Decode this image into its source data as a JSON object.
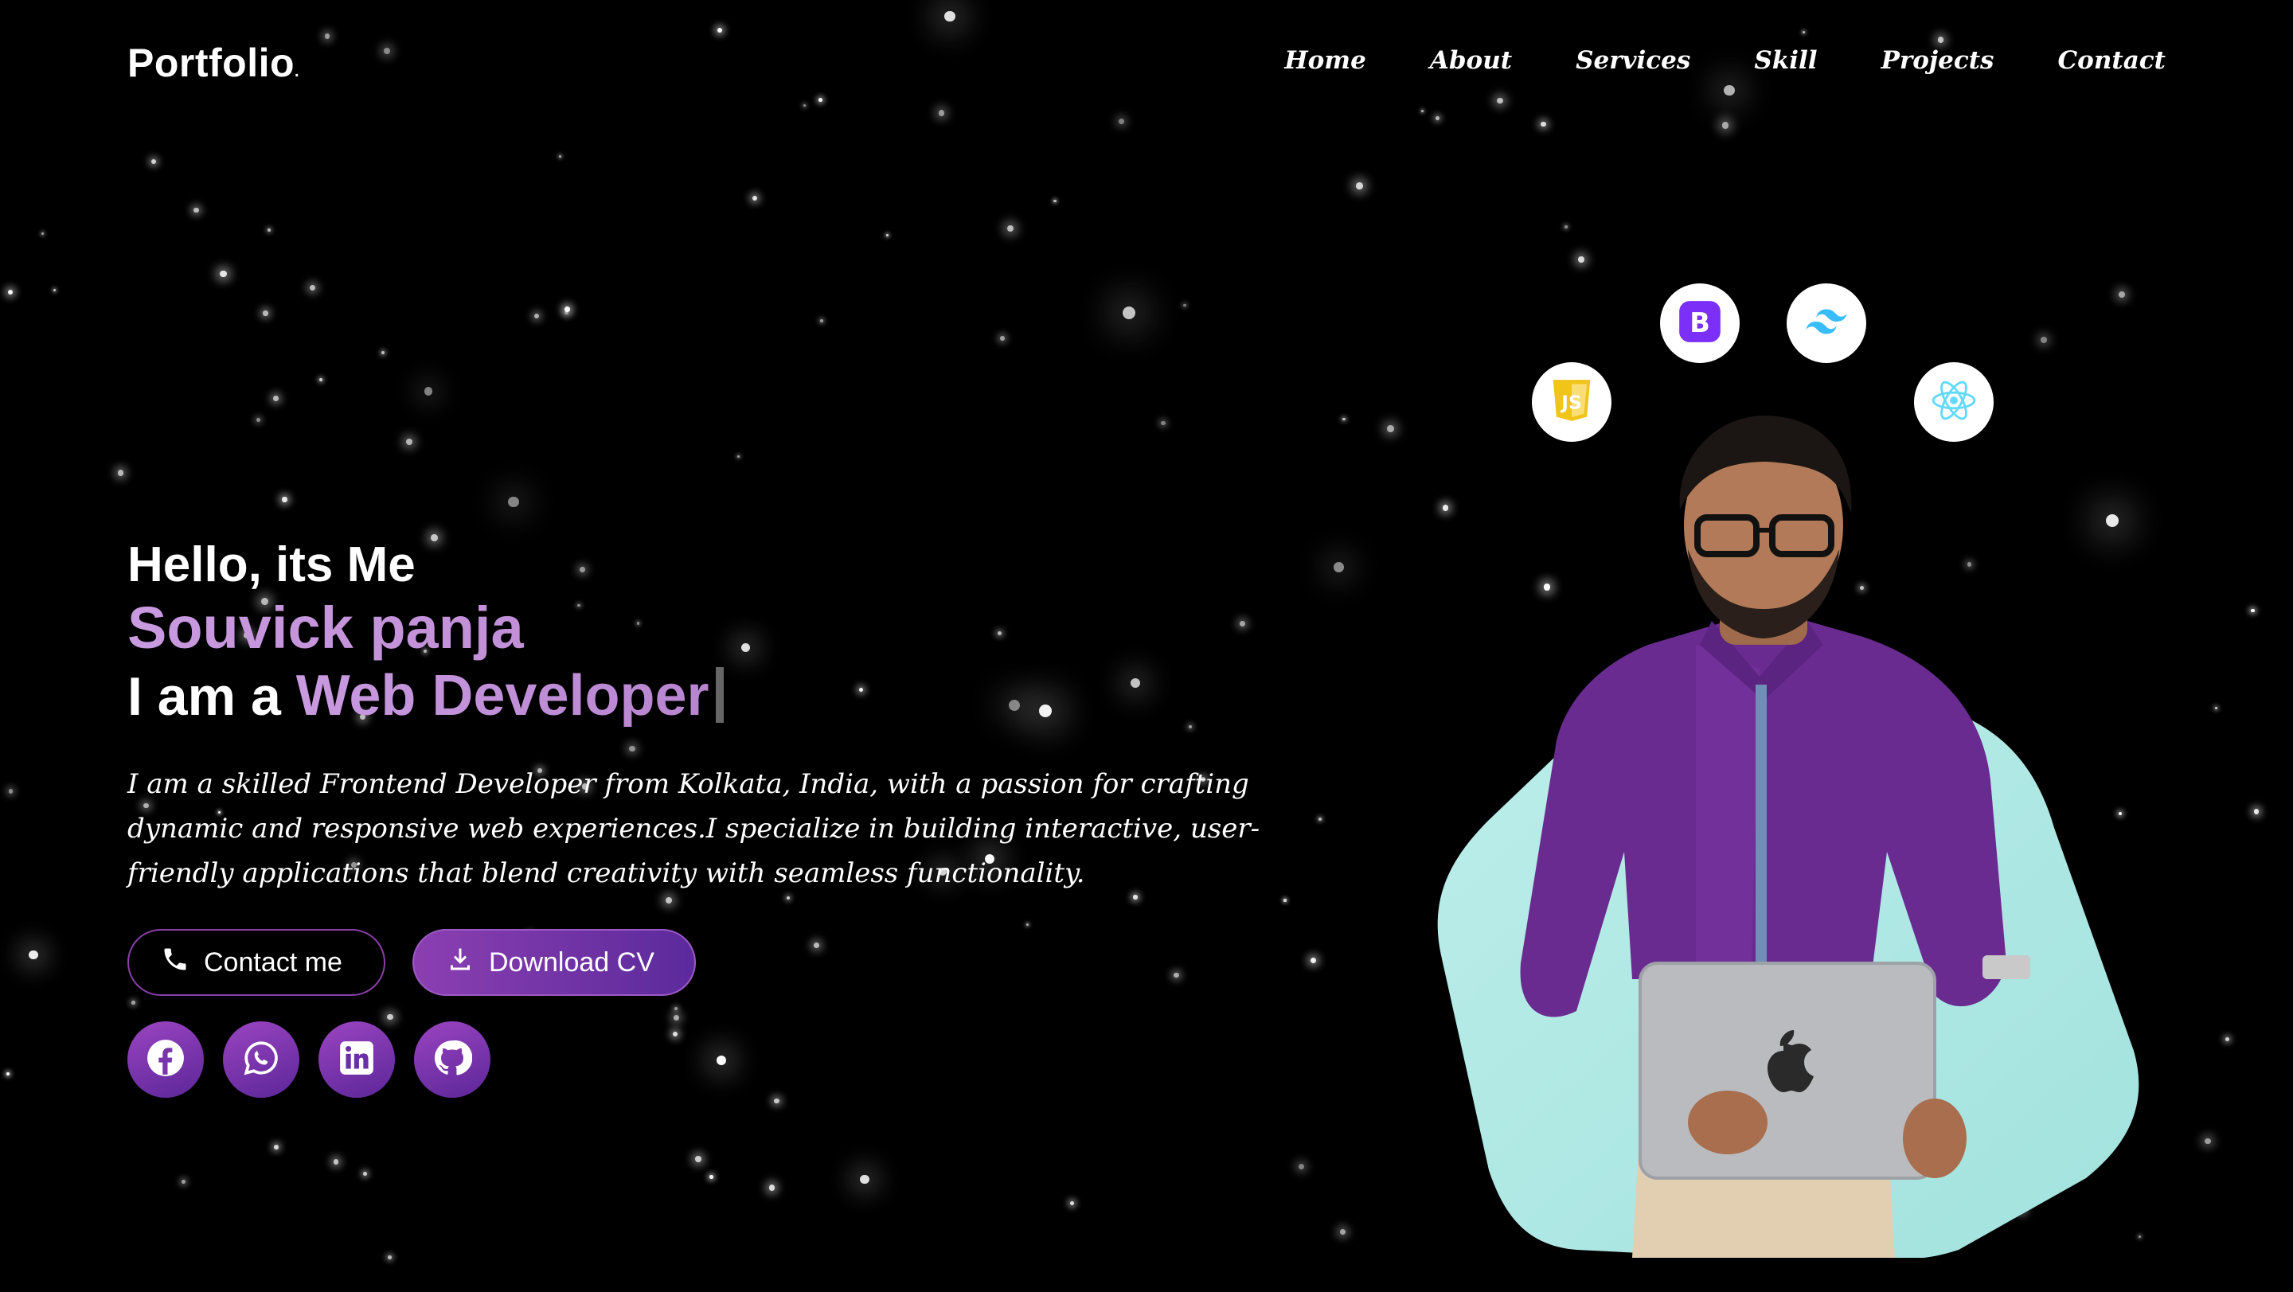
{
  "header": {
    "logo": "Portfolio",
    "logo_dot": ".",
    "nav": [
      "Home",
      "About",
      "Services",
      "Skill",
      "Projects",
      "Contact"
    ]
  },
  "hero": {
    "greeting": "Hello, its Me",
    "name": "Souvick panja",
    "role_prefix": "I am a",
    "role_typed": "Web Developer",
    "description": "I am a skilled Frontend Developer from Kolkata, India, with a passion for crafting dynamic and responsive web experiences.I specialize in building interactive, user-friendly applications that blend creativity with seamless functionality.",
    "contact_button": "Contact me",
    "cv_button": "Download CV"
  },
  "socials": [
    {
      "icon": "facebook-icon"
    },
    {
      "icon": "whatsapp-icon"
    },
    {
      "icon": "linkedin-icon"
    },
    {
      "icon": "github-icon"
    }
  ],
  "tech_badges": [
    {
      "icon": "javascript-icon",
      "color": "#f0c419"
    },
    {
      "icon": "bootstrap-icon",
      "color": "#7b2ff7"
    },
    {
      "icon": "tailwind-icon",
      "color": "#38bdf8"
    },
    {
      "icon": "react-icon",
      "color": "#61dafb"
    }
  ],
  "colors": {
    "accent": "#b985d0",
    "button_gradient_start": "#8b3fb1",
    "button_gradient_end": "#5b2a9c",
    "blob": "#a9e6e2",
    "shirt": "#6b2c91"
  }
}
